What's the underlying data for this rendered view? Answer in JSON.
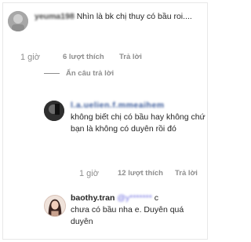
{
  "comments": [
    {
      "username": "yeuma198",
      "text": "Nhìn là bk chị thuy có bầu roi....",
      "time": "1 giờ",
      "likes": "6 lượt thích",
      "reply_label": "Trả lời"
    },
    {
      "username": "l.a.uelien.f.mmeaihem",
      "text": "không biết chị có bầu hay không chứ bạn là không có duyên rồi đó",
      "time": "1 giờ",
      "likes": "12 lượt thích",
      "reply_label": "Trả lời"
    },
    {
      "username": "baothy.tran",
      "mention": "@y*******",
      "mention_tail": "c",
      "text": "chưa có bầu nha e. Duyên quá duyên"
    }
  ],
  "hide_replies_label": "Ẩn câu trả lời"
}
